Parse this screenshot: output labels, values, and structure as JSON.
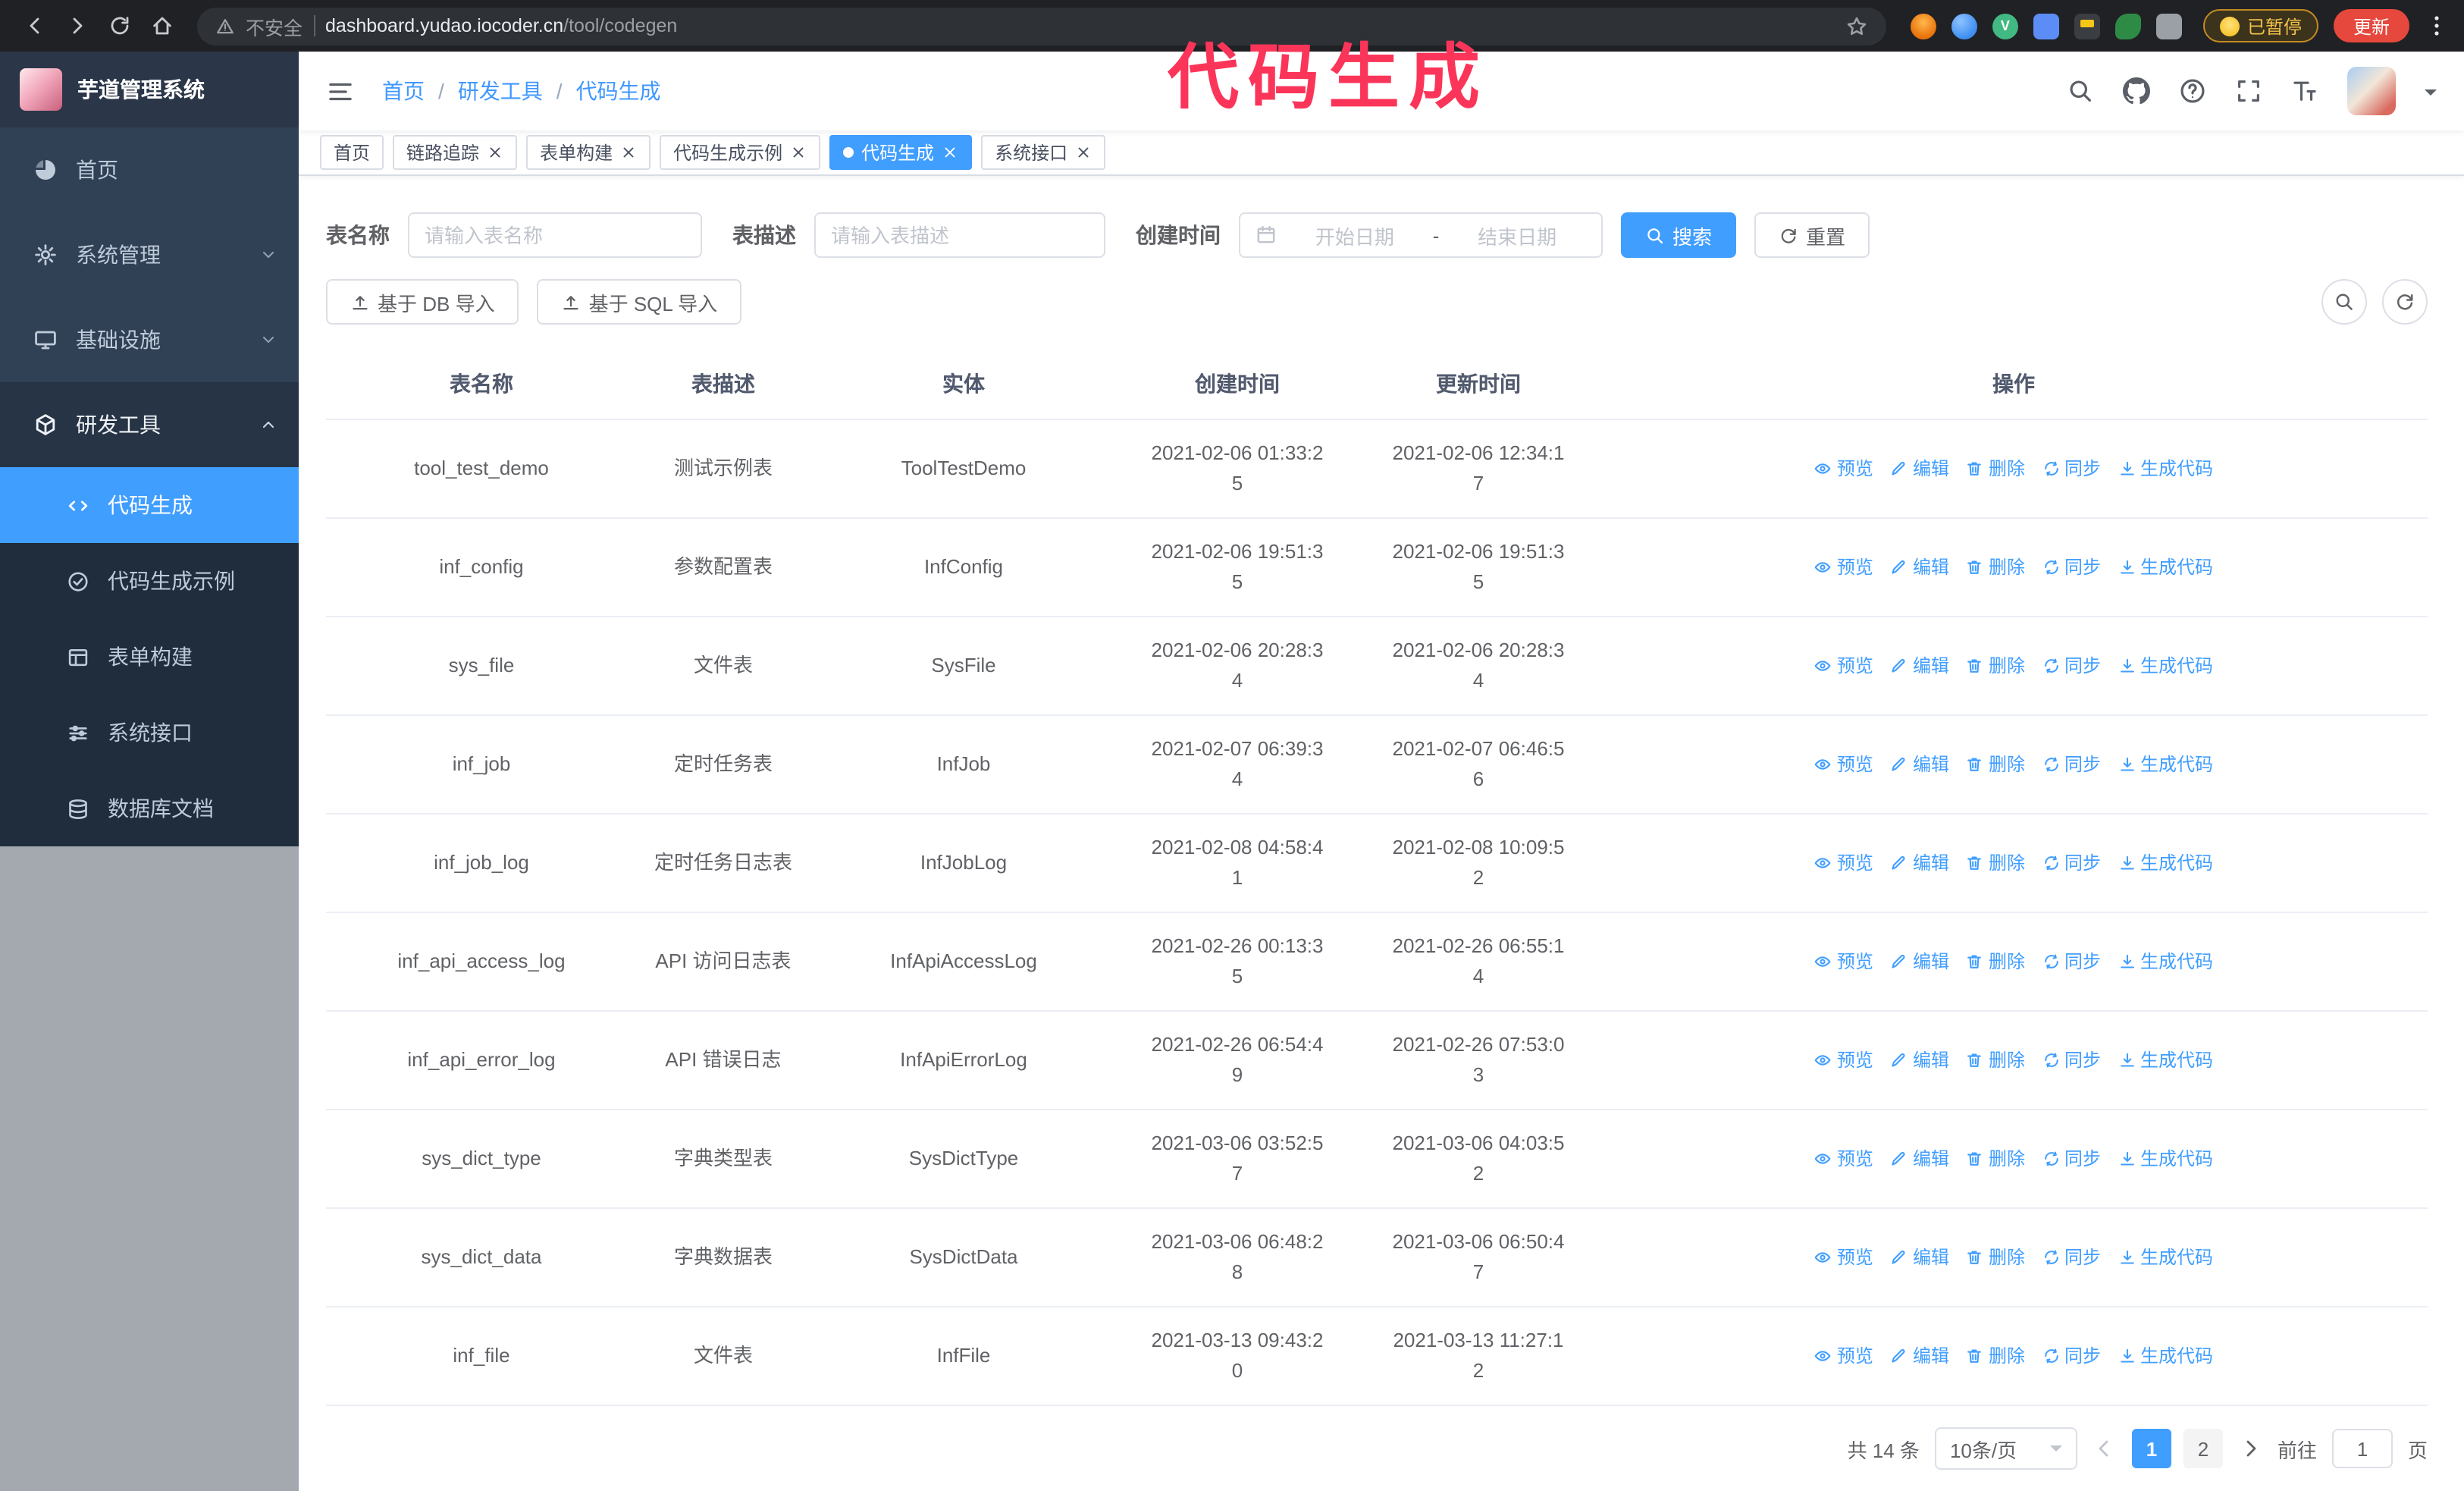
{
  "browser": {
    "security_label": "不安全",
    "url_domain": "dashboard.yudao.iocoder.cn",
    "url_path": "/tool/codegen",
    "paused_badge": "已暂停",
    "update_button": "更新"
  },
  "annotation": {
    "text": "代码生成",
    "color": "#fb3559"
  },
  "sidebar": {
    "logo_title": "芋道管理系统",
    "items": [
      {
        "key": "home",
        "label": "首页",
        "icon": "dashboard"
      },
      {
        "key": "system",
        "label": "系统管理",
        "icon": "gear",
        "expandable": true,
        "expanded": false
      },
      {
        "key": "infra",
        "label": "基础设施",
        "icon": "monitor",
        "expandable": true,
        "expanded": false
      },
      {
        "key": "devtools",
        "label": "研发工具",
        "icon": "tools",
        "expandable": true,
        "expanded": true,
        "children": [
          {
            "key": "codegen",
            "label": "代码生成",
            "icon": "code",
            "active": true
          },
          {
            "key": "codegen-demo",
            "label": "代码生成示例",
            "icon": "badge",
            "active": false
          },
          {
            "key": "form-build",
            "label": "表单构建",
            "icon": "form",
            "active": false
          },
          {
            "key": "api",
            "label": "系统接口",
            "icon": "api",
            "active": false
          },
          {
            "key": "db-doc",
            "label": "数据库文档",
            "icon": "database",
            "active": false
          }
        ]
      }
    ]
  },
  "header": {
    "breadcrumb": [
      "首页",
      "研发工具",
      "代码生成"
    ],
    "breadcrumb_separator": "/"
  },
  "tabs": [
    {
      "key": "home",
      "label": "首页",
      "closable": false,
      "active": false
    },
    {
      "key": "tracer",
      "label": "链路追踪",
      "closable": true,
      "active": false
    },
    {
      "key": "form-build",
      "label": "表单构建",
      "closable": true,
      "active": false
    },
    {
      "key": "codegen-demo",
      "label": "代码生成示例",
      "closable": true,
      "active": false
    },
    {
      "key": "codegen",
      "label": "代码生成",
      "closable": true,
      "active": true
    },
    {
      "key": "api",
      "label": "系统接口",
      "closable": true,
      "active": false
    }
  ],
  "filters": {
    "table_name_label": "表名称",
    "table_name_placeholder": "请输入表名称",
    "table_desc_label": "表描述",
    "table_desc_placeholder": "请输入表描述",
    "create_time_label": "创建时间",
    "date_start_placeholder": "开始日期",
    "date_separator": "-",
    "date_end_placeholder": "结束日期",
    "search_button": "搜索",
    "reset_button": "重置"
  },
  "toolbar": {
    "import_db": "基于 DB 导入",
    "import_sql": "基于 SQL 导入"
  },
  "table": {
    "columns": [
      "表名称",
      "表描述",
      "实体",
      "创建时间",
      "更新时间",
      "操作"
    ],
    "row_actions": [
      {
        "key": "preview",
        "label": "预览",
        "icon": "eye"
      },
      {
        "key": "edit",
        "label": "编辑",
        "icon": "edit"
      },
      {
        "key": "delete",
        "label": "删除",
        "icon": "del"
      },
      {
        "key": "sync",
        "label": "同步",
        "icon": "sync"
      },
      {
        "key": "generate",
        "label": "生成代码",
        "icon": "download"
      }
    ],
    "rows": [
      {
        "name": "tool_test_demo",
        "desc": "测试示例表",
        "entity": "ToolTestDemo",
        "created": "2021-02-06 01:33:25",
        "updated": "2021-02-06 12:34:17"
      },
      {
        "name": "inf_config",
        "desc": "参数配置表",
        "entity": "InfConfig",
        "created": "2021-02-06 19:51:35",
        "updated": "2021-02-06 19:51:35"
      },
      {
        "name": "sys_file",
        "desc": "文件表",
        "entity": "SysFile",
        "created": "2021-02-06 20:28:34",
        "updated": "2021-02-06 20:28:34"
      },
      {
        "name": "inf_job",
        "desc": "定时任务表",
        "entity": "InfJob",
        "created": "2021-02-07 06:39:34",
        "updated": "2021-02-07 06:46:56"
      },
      {
        "name": "inf_job_log",
        "desc": "定时任务日志表",
        "entity": "InfJobLog",
        "created": "2021-02-08 04:58:41",
        "updated": "2021-02-08 10:09:52"
      },
      {
        "name": "inf_api_access_log",
        "desc": "API 访问日志表",
        "entity": "InfApiAccessLog",
        "created": "2021-02-26 00:13:35",
        "updated": "2021-02-26 06:55:14"
      },
      {
        "name": "inf_api_error_log",
        "desc": "API 错误日志",
        "entity": "InfApiErrorLog",
        "created": "2021-02-26 06:54:49",
        "updated": "2021-02-26 07:53:03"
      },
      {
        "name": "sys_dict_type",
        "desc": "字典类型表",
        "entity": "SysDictType",
        "created": "2021-03-06 03:52:57",
        "updated": "2021-03-06 04:03:52"
      },
      {
        "name": "sys_dict_data",
        "desc": "字典数据表",
        "entity": "SysDictData",
        "created": "2021-03-06 06:48:28",
        "updated": "2021-03-06 06:50:47"
      },
      {
        "name": "inf_file",
        "desc": "文件表",
        "entity": "InfFile",
        "created": "2021-03-13 09:43:20",
        "updated": "2021-03-13 11:27:12"
      }
    ]
  },
  "pagination": {
    "total_text": "共 14 条",
    "page_size": "10条/页",
    "pages": [
      "1",
      "2"
    ],
    "active_page": "1",
    "goto_label": "前往",
    "goto_value": "1",
    "goto_suffix": "页"
  },
  "colors": {
    "primary": "#409eff",
    "sidebar_bg": "#304156",
    "submenu_bg": "#1f2d3d"
  }
}
